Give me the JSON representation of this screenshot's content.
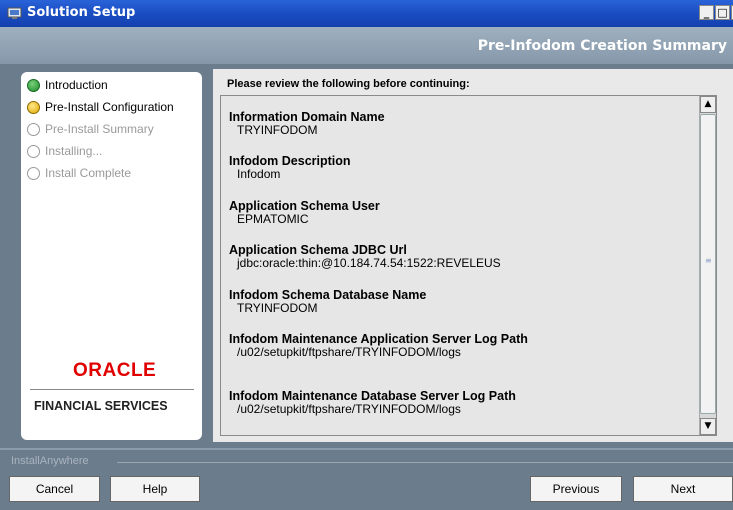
{
  "window": {
    "title": "Solution Setup",
    "minimize_label": "_",
    "maximize_label": "□",
    "close_label": "x"
  },
  "header": {
    "title": "Pre-Infodom Creation Summary"
  },
  "steps": [
    {
      "label": "Introduction",
      "state": "done"
    },
    {
      "label": "Pre-Install Configuration",
      "state": "current"
    },
    {
      "label": "Pre-Install Summary",
      "state": "pending"
    },
    {
      "label": "Installing...",
      "state": "pending"
    },
    {
      "label": "Install Complete",
      "state": "pending"
    }
  ],
  "branding": {
    "logo": "ORACLE",
    "subtitle": "FINANCIAL SERVICES"
  },
  "main": {
    "review_label": "Please review the following before continuing:",
    "fields": [
      {
        "label": "Information Domain Name",
        "value": "TRYINFODOM"
      },
      {
        "label": "Infodom Description",
        "value": "Infodom"
      },
      {
        "label": "Application Schema User",
        "value": "EPMATOMIC"
      },
      {
        "label": "Application Schema JDBC Url",
        "value": "jdbc:oracle:thin:@10.184.74.54:1522:REVELEUS"
      },
      {
        "label": "Infodom Schema Database Name",
        "value": "TRYINFODOM"
      },
      {
        "label": "Infodom Maintenance Application Server Log Path",
        "value": "/u02/setupkit/ftpshare/TRYINFODOM/logs"
      },
      {
        "label": "Infodom Maintenance Database Server Log Path",
        "value": "/u02/setupkit/ftpshare/TRYINFODOM/logs"
      }
    ]
  },
  "footer": {
    "installer_label": "InstallAnywhere",
    "cancel_label": "Cancel",
    "help_label": "Help",
    "previous_label": "Previous",
    "next_label": "Next"
  },
  "colors": {
    "titlebar": "#1b4fc4",
    "header": "#8fa1b3",
    "oracle_red": "#e00000"
  }
}
